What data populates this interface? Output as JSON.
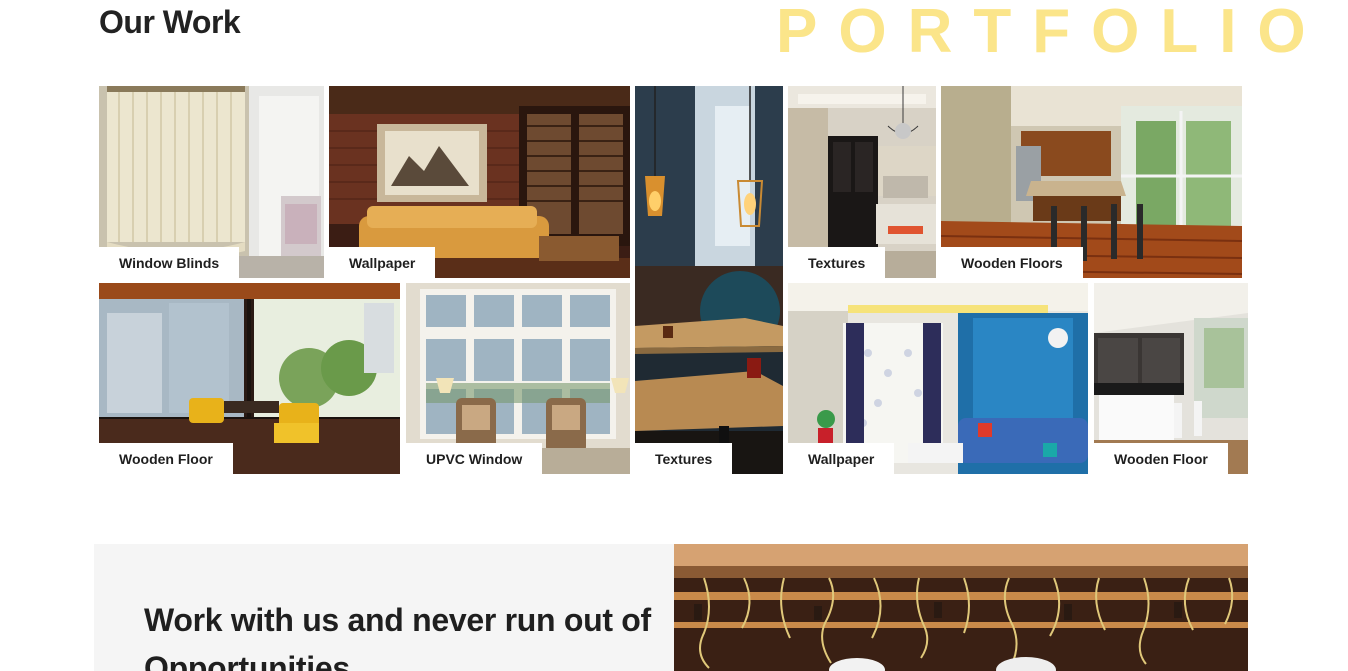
{
  "header": {
    "title": "Our Work",
    "background_word": "PORTFOLIO"
  },
  "portfolio": {
    "tiles": [
      {
        "label": "Window Blinds"
      },
      {
        "label": "Wallpaper"
      },
      {
        "label": "Textures"
      },
      {
        "label": "Textures"
      },
      {
        "label": "Wooden Floors"
      },
      {
        "label": "Wooden Floor"
      },
      {
        "label": "UPVC Window"
      },
      {
        "label": "Wallpaper"
      },
      {
        "label": "Wooden Floor"
      }
    ]
  },
  "cta": {
    "heading": "Work with us and never run out of Opportunities"
  },
  "colors": {
    "accent_watermark": "#fbe58a",
    "cta_background": "#f5f5f5",
    "label_background": "#ffffff",
    "text_dark": "#1f1f1f"
  }
}
